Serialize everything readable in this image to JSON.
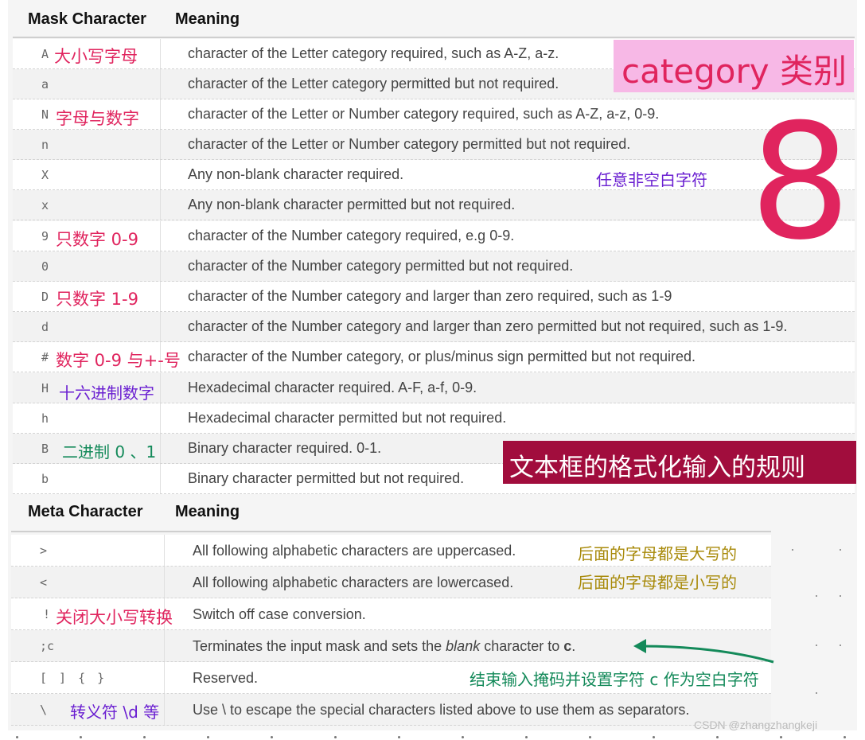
{
  "mask_table": {
    "header_code": "Mask Character",
    "header_meaning": "Meaning",
    "rows": [
      {
        "code": "A",
        "note": "大小写字母",
        "meaning": "character of the Letter category required, such as A-Z, a-z."
      },
      {
        "code": "a",
        "note": "",
        "meaning": "character of the Letter category permitted but not required."
      },
      {
        "code": "N",
        "note": "字母与数字",
        "meaning": "character of the Letter or Number category required, such as A-Z, a-z, 0-9."
      },
      {
        "code": "n",
        "note": "",
        "meaning": "character of the Letter or Number category permitted but not required."
      },
      {
        "code": "X",
        "note": "",
        "meaning": "Any non-blank character required."
      },
      {
        "code": "x",
        "note": "",
        "meaning": "Any non-blank character permitted but not required."
      },
      {
        "code": "9",
        "note": "只数字 0-9",
        "meaning": "character of the Number category required, e.g 0-9."
      },
      {
        "code": "0",
        "note": "",
        "meaning": "character of the Number category permitted but not required."
      },
      {
        "code": "D",
        "note": "只数字 1-9",
        "meaning": "character of the Number category and larger than zero required, such as 1-9"
      },
      {
        "code": "d",
        "note": "",
        "meaning": "character of the Number category and larger than zero permitted but not required, such as 1-9."
      },
      {
        "code": "#",
        "note": "数字 0-9 与+-号",
        "meaning": "character of the Number category, or plus/minus sign permitted but not required."
      },
      {
        "code": "H",
        "note": "十六进制数字",
        "meaning": "Hexadecimal character required. A-F, a-f, 0-9."
      },
      {
        "code": "h",
        "note": "",
        "meaning": "Hexadecimal character permitted but not required."
      },
      {
        "code": "B",
        "note": "二进制 0 、1",
        "meaning": "Binary character required. 0-1."
      },
      {
        "code": "b",
        "note": "",
        "meaning": "Binary character permitted but not required."
      }
    ]
  },
  "meta_table": {
    "header_code": "Meta Character",
    "header_meaning": "Meaning",
    "rows": [
      {
        "code": ">",
        "note": "",
        "meaning": "All following alphabetic characters are uppercased.",
        "side_note": "后面的字母都是大写的"
      },
      {
        "code": "<",
        "note": "",
        "meaning": "All following alphabetic characters are lowercased.",
        "side_note": "后面的字母都是小写的"
      },
      {
        "code": "!",
        "note": "关闭大小写转换",
        "meaning": "Switch off case conversion.",
        "side_note": ""
      },
      {
        "code": ";c",
        "note": "",
        "meaning_pre": "Terminates the input mask and sets the ",
        "meaning_em": "blank",
        "meaning_mid": " character to ",
        "meaning_b": "c",
        "meaning_post": ".",
        "side_note": ""
      },
      {
        "code": "[ ] { }",
        "note": "",
        "meaning": "Reserved.",
        "side_note": "结束输入掩码并设置字符 c 作为空白字符"
      },
      {
        "code": "\\",
        "note": "转义符 \\d 等",
        "meaning": "Use \\ to escape the special characters listed above to use them as separators.",
        "side_note": ""
      }
    ]
  },
  "annotations": {
    "category": "category 类别",
    "eight": "8",
    "nonblank": "任意非空白字符",
    "title": "文本框的格式化输入的规则"
  },
  "colors": {
    "red": "#e0245e",
    "purple": "#6a1fd1",
    "green": "#148a5a",
    "olive": "#a88a0a",
    "pink_bg": "#f7b8e6",
    "title_bg": "#a10d3d"
  },
  "watermark": "CSDN @zhangzhangkeji"
}
